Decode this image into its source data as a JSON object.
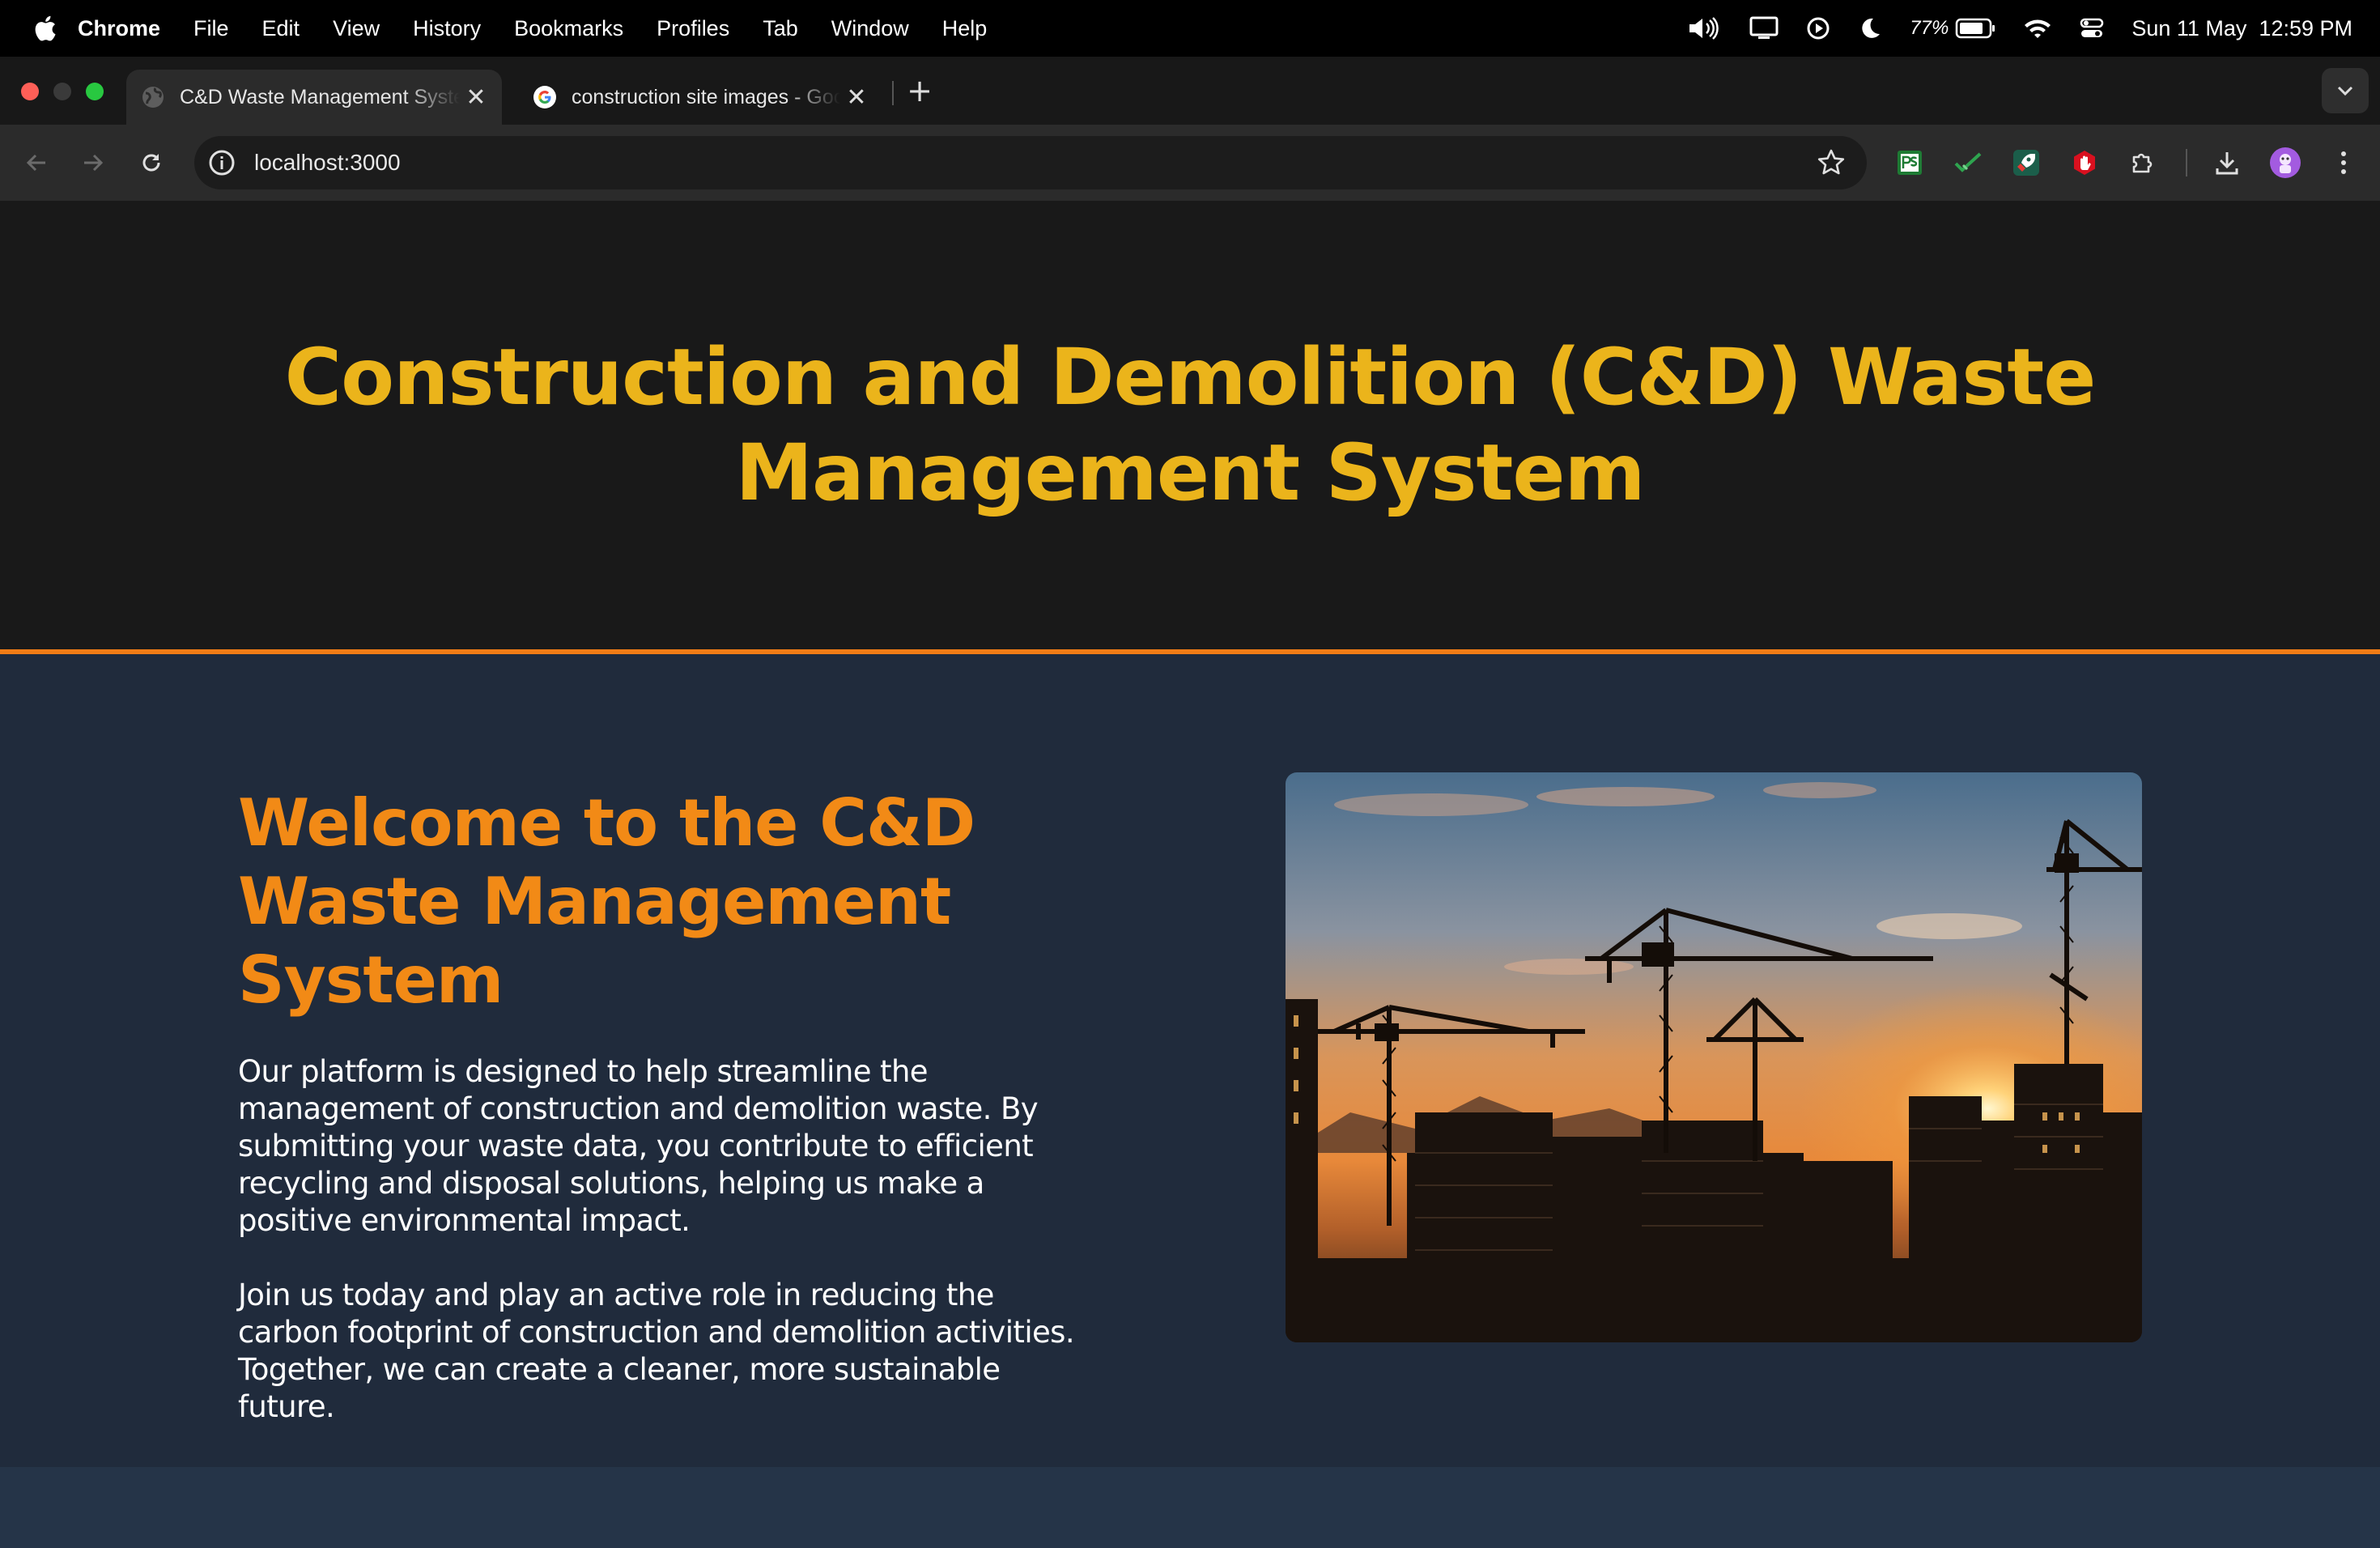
{
  "menubar": {
    "app_name": "Chrome",
    "items": [
      "File",
      "Edit",
      "View",
      "History",
      "Bookmarks",
      "Profiles",
      "Tab",
      "Window",
      "Help"
    ],
    "battery_percent": "77%",
    "datetime": "Sun 11 May  12:59 PM"
  },
  "tabs": [
    {
      "title": "C&D Waste Management System",
      "active": true
    },
    {
      "title": "construction site images - Google Search",
      "active": false
    }
  ],
  "toolbar": {
    "url": "localhost:3000"
  },
  "page": {
    "title": "Construction and Demolition (C&D) Waste Management System",
    "welcome_heading": "Welcome to the C&D Waste Management System",
    "paragraph_1": "Our platform is designed to help streamline the management of construction and demolition waste. By submitting your waste data, you contribute to efficient recycling and disposal solutions, helping us make a positive environmental impact.",
    "paragraph_2": "Join us today and play an active role in reducing the carbon footprint of construction and demolition activities. Together, we can create a cleaner, more sustainable future."
  },
  "colors": {
    "header_bg": "#191919",
    "title_yellow": "#ebb41b",
    "accent_orange": "#f07c16",
    "section_bg": "#202b3c",
    "footer_bg": "#253448"
  },
  "icons": {
    "menubar": [
      "apple-logo-icon",
      "volume-icon",
      "display-icon",
      "play-circle-icon",
      "moon-icon",
      "battery-icon",
      "wifi-icon",
      "control-center-icon"
    ],
    "toolbar": [
      "back-arrow-icon",
      "forward-arrow-icon",
      "reload-icon",
      "site-info-icon",
      "bookmark-star-icon",
      "extension-ps-icon",
      "extension-check-icon",
      "extension-rocket-icon",
      "extension-hand-icon",
      "extensions-puzzle-icon",
      "download-icon",
      "profile-avatar-icon",
      "kebab-menu-icon"
    ]
  }
}
